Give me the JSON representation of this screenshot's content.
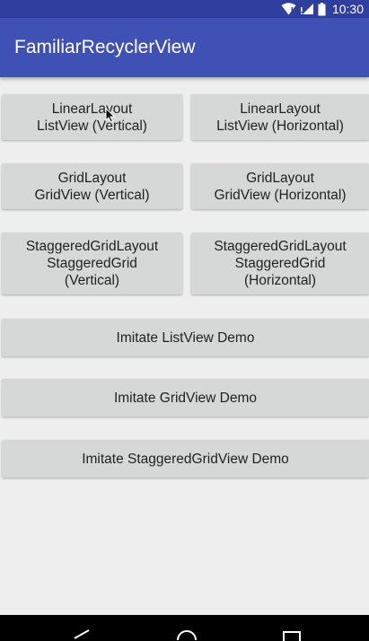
{
  "status_bar": {
    "time": "10:30",
    "icons": [
      "wifi-icon",
      "signal-icon",
      "battery-icon"
    ],
    "background": "#303f9f"
  },
  "app_bar": {
    "title": "FamiliarRecyclerView",
    "background": "#3f51b5"
  },
  "buttons": {
    "linear_vertical": [
      "LinearLayout",
      "ListView (Vertical)"
    ],
    "linear_horizontal": [
      "LinearLayout",
      "ListView (Horizontal)"
    ],
    "grid_vertical": [
      "GridLayout",
      "GridView (Vertical)"
    ],
    "grid_horizontal": [
      "GridLayout",
      "GridView (Horizontal)"
    ],
    "staggered_vertical": [
      "StaggeredGridLayout",
      "StaggeredGrid",
      "(Vertical)"
    ],
    "staggered_horizontal": [
      "StaggeredGridLayout",
      "StaggeredGrid",
      "(Horizontal)"
    ],
    "imitate_listview": "Imitate ListView Demo",
    "imitate_gridview": "Imitate GridView Demo",
    "imitate_staggered": "Imitate StaggeredGridView Demo"
  },
  "nav_bar": {
    "icons": [
      "back-icon",
      "home-icon",
      "recents-icon"
    ]
  },
  "colors": {
    "button_bg": "#d6d7d7",
    "page_bg": "#eeeeee"
  }
}
